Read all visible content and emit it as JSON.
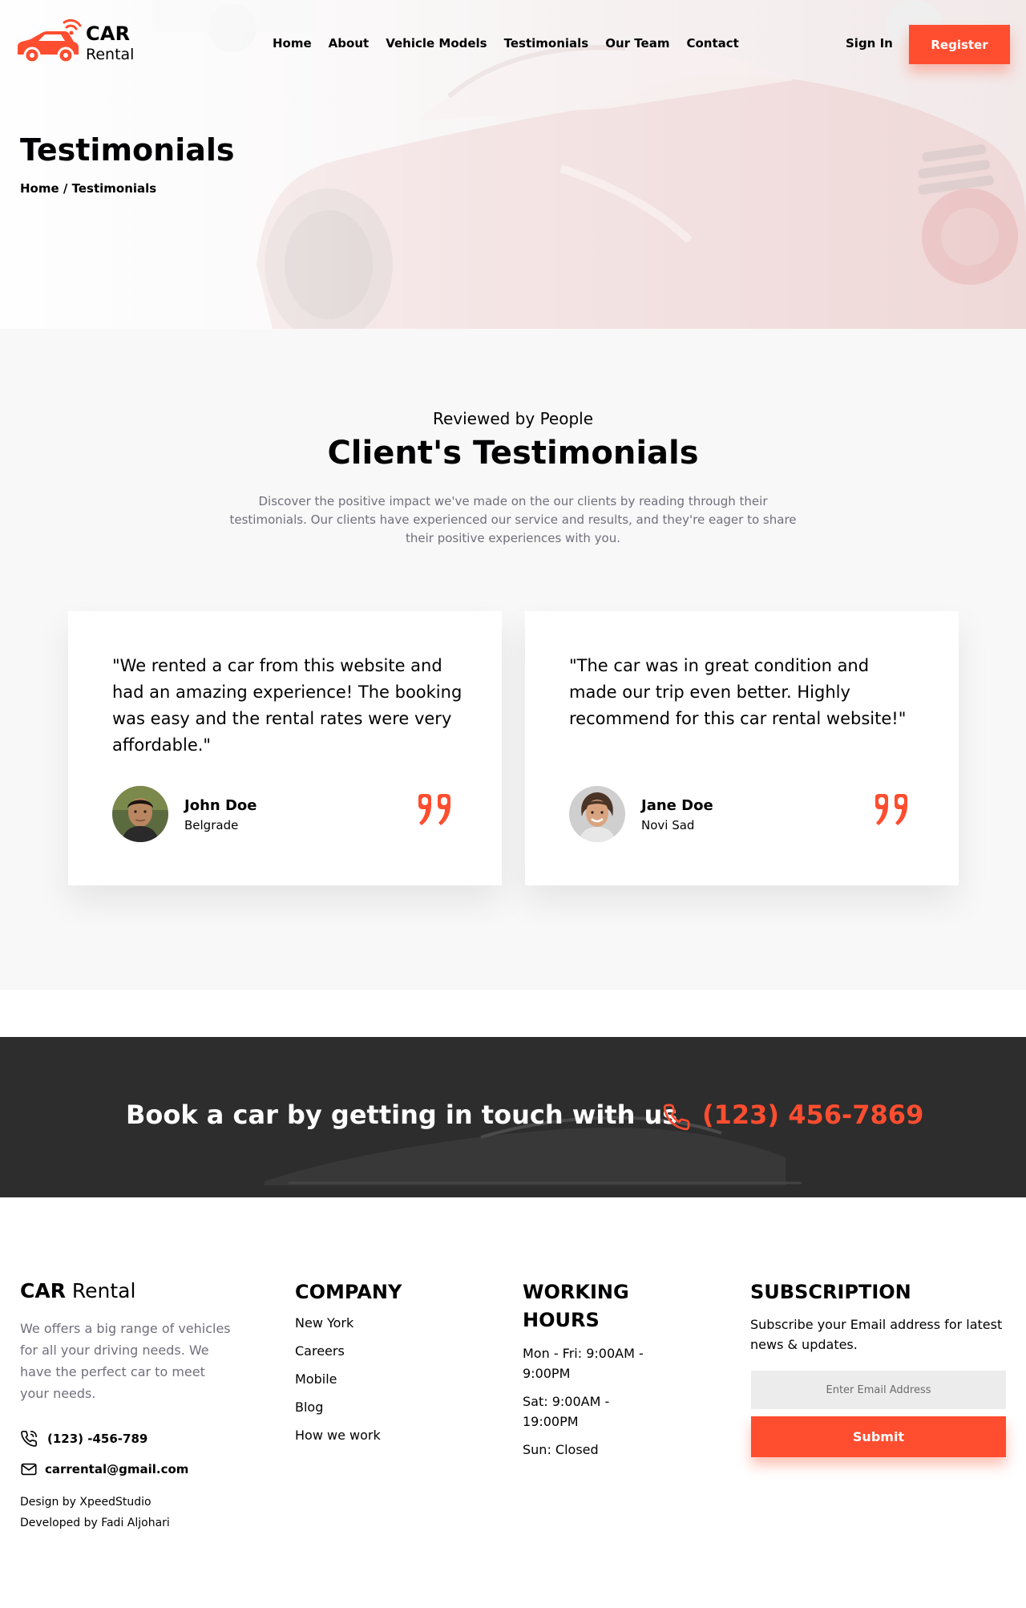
{
  "brand": {
    "name_bold": "CAR",
    "name_light": "Rental"
  },
  "nav": {
    "links": [
      "Home",
      "About",
      "Vehicle Models",
      "Testimonials",
      "Our Team",
      "Contact"
    ],
    "sign_in": "Sign In",
    "register": "Register"
  },
  "hero": {
    "title": "Testimonials",
    "breadcrumb_home": "Home",
    "breadcrumb_sep": " / ",
    "breadcrumb_current": "Testimonials"
  },
  "testimonials": {
    "kicker": "Reviewed by People",
    "heading": "Client's Testimonials",
    "description": "Discover the positive impact we've made on the our clients by reading through their testimonials. Our clients have experienced our service and results, and they're eager to share their positive experiences with you.",
    "items": [
      {
        "quote": "\"We rented a car from this website and had an amazing experience! The booking was easy and the rental rates were very affordable.\"",
        "name": "John Doe",
        "city": "Belgrade"
      },
      {
        "quote": "\"The car was in great condition and made our trip even better. Highly recommend for this car rental website!\"",
        "name": "Jane Doe",
        "city": "Novi Sad"
      }
    ]
  },
  "book_banner": {
    "text": "Book a car by getting in touch with us",
    "phone": "(123) 456-7869"
  },
  "footer": {
    "brand_bold": "CAR",
    "brand_light": " Rental",
    "about": "We offers a big range of vehicles for all your driving needs. We have the perfect car to meet your needs.",
    "phone": "(123) -456-789",
    "email": "carrental@gmail.com",
    "credit_design": "Design by XpeedStudio",
    "credit_dev": "Developed by Fadi Aljohari",
    "company_title": "COMPANY",
    "company_links": [
      "New York",
      "Careers",
      "Mobile",
      "Blog",
      "How we work"
    ],
    "hours_title": "WORKING HOURS",
    "hours": [
      "Mon - Fri: 9:00AM - 9:00PM",
      "Sat: 9:00AM - 19:00PM",
      "Sun: Closed"
    ],
    "subscription_title": "SUBSCRIPTION",
    "subscription_text": "Subscribe your Email address for latest news & updates.",
    "email_placeholder": "Enter Email Address",
    "submit": "Submit"
  },
  "colors": {
    "accent": "#ff4d30",
    "text": "#010103",
    "muted": "#706f7b",
    "section_bg": "#f8f8f8",
    "banner_bg": "#2d2d2d"
  },
  "icons": [
    "car-wifi-logo-icon",
    "quote-icon",
    "phone-icon",
    "mail-icon"
  ]
}
